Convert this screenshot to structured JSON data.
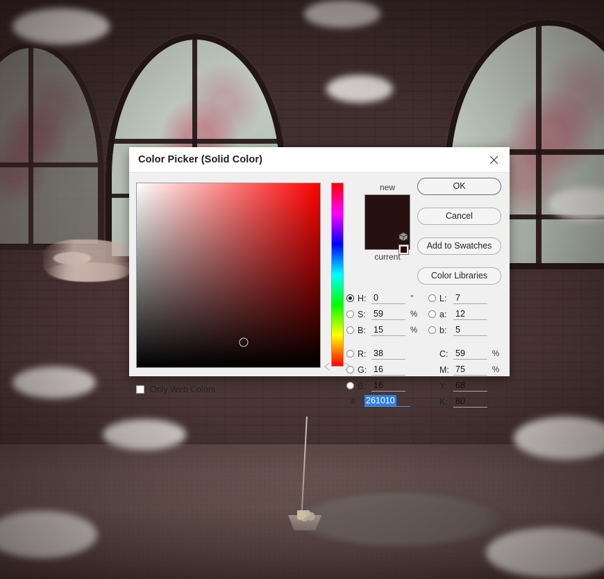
{
  "dialog": {
    "title": "Color Picker (Solid Color)",
    "close_icon": "close-icon"
  },
  "buttons": {
    "ok": "OK",
    "cancel": "Cancel",
    "add_to_swatches": "Add to Swatches",
    "color_libraries": "Color Libraries"
  },
  "preview": {
    "new_label": "new",
    "current_label": "current",
    "new_color": "#261010",
    "current_color": "#261010",
    "websafe_color": "#330000",
    "gamut_icon": "cube-icon"
  },
  "picker": {
    "hue": 0,
    "saturation": 59,
    "brightness": 15,
    "marker_x_pct": 58.5,
    "marker_y_pct": 86.5,
    "hue_marker_pct": 100
  },
  "fields": {
    "hsb": [
      {
        "name": "H:",
        "value": "0",
        "unit": "°",
        "selected": true
      },
      {
        "name": "S:",
        "value": "59",
        "unit": "%",
        "selected": false
      },
      {
        "name": "B:",
        "value": "15",
        "unit": "%",
        "selected": false
      }
    ],
    "rgb": [
      {
        "name": "R:",
        "value": "38",
        "unit": "",
        "selected": false
      },
      {
        "name": "G:",
        "value": "16",
        "unit": "",
        "selected": false
      },
      {
        "name": "B:",
        "value": "16",
        "unit": "",
        "selected": false
      }
    ],
    "lab": [
      {
        "name": "L:",
        "value": "7",
        "unit": "",
        "selected": false
      },
      {
        "name": "a:",
        "value": "12",
        "unit": "",
        "selected": false
      },
      {
        "name": "b:",
        "value": "5",
        "unit": "",
        "selected": false
      }
    ],
    "cmyk": [
      {
        "name": "C:",
        "value": "59",
        "unit": "%"
      },
      {
        "name": "M:",
        "value": "75",
        "unit": "%"
      },
      {
        "name": "Y:",
        "value": "68",
        "unit": "%"
      },
      {
        "name": "K:",
        "value": "80",
        "unit": "%"
      }
    ],
    "hex_hash": "#",
    "hex_value": "261010"
  },
  "options": {
    "only_web_colors_label": "Only Web Colors",
    "only_web_colors_checked": false
  },
  "colors": {
    "accent_selection": "#2f7fe4",
    "dialog_bg": "#f0f0f0",
    "titlebar_bg": "#ffffff"
  }
}
